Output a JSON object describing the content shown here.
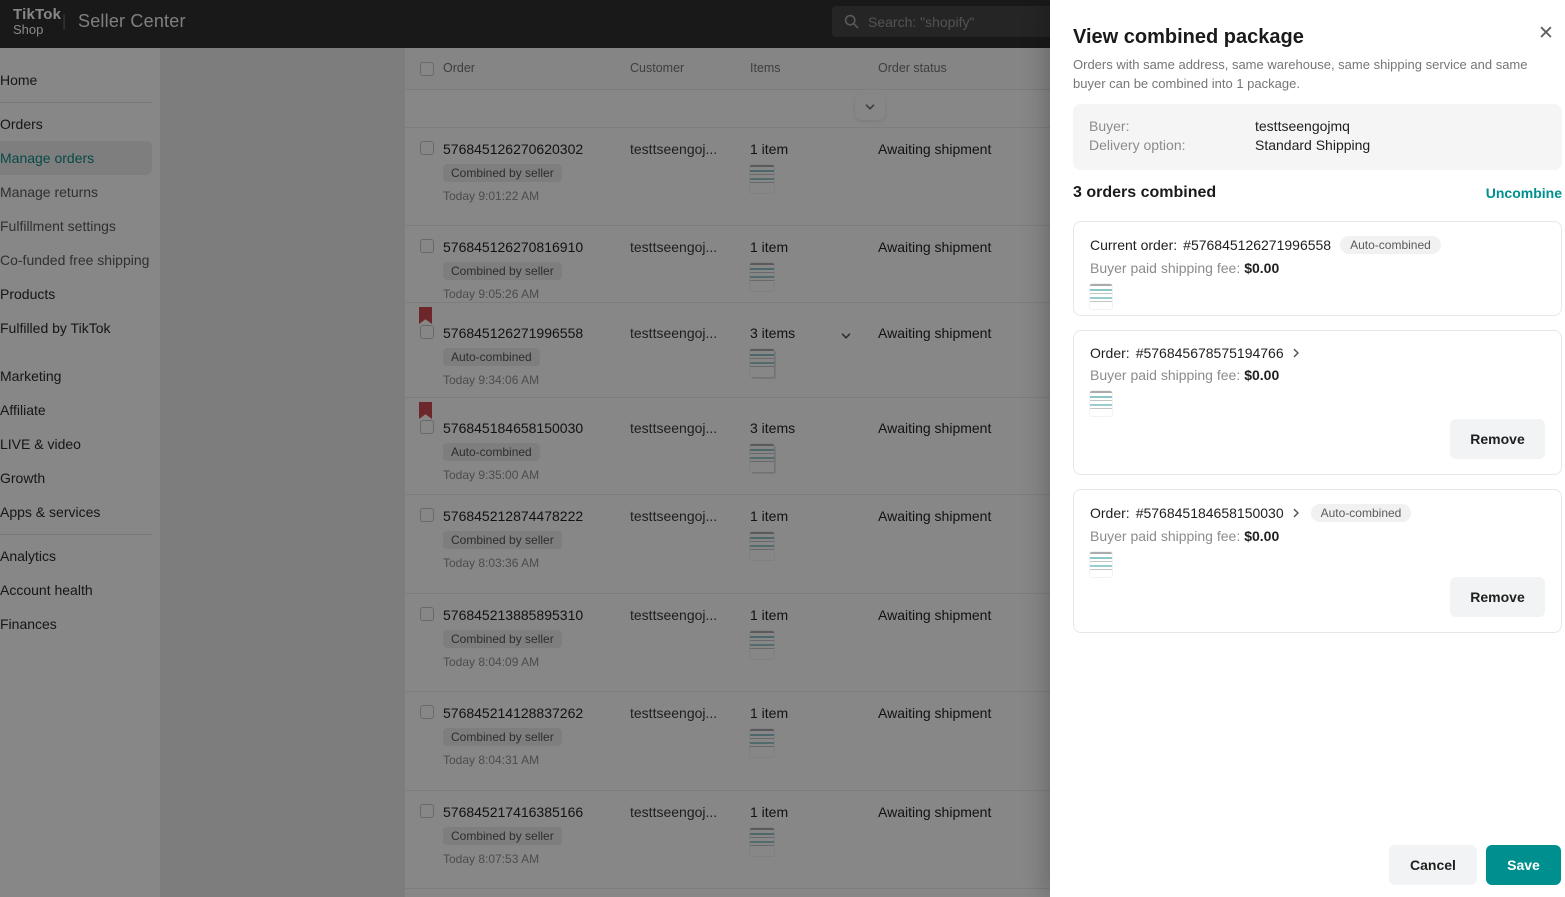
{
  "topbar": {
    "logo_line1": "TikTok",
    "logo_line2": "Shop",
    "divider": "|",
    "app_title": "Seller Center",
    "search_placeholder": "Search: \"shopify\""
  },
  "sidebar": {
    "items": [
      {
        "label": "Home"
      },
      {
        "label": "Orders"
      },
      {
        "label": "Manage orders",
        "active": true
      },
      {
        "label": "Manage returns"
      },
      {
        "label": "Fulfillment settings"
      },
      {
        "label": "Co-funded free shipping"
      },
      {
        "label": "Products"
      },
      {
        "label": "Fulfilled by TikTok"
      },
      {
        "label": "Marketing"
      },
      {
        "label": "Affiliate"
      },
      {
        "label": "LIVE & video"
      },
      {
        "label": "Growth"
      },
      {
        "label": "Apps & services"
      },
      {
        "label": "Analytics"
      },
      {
        "label": "Account health"
      },
      {
        "label": "Finances"
      }
    ]
  },
  "table": {
    "columns": {
      "order": "Order",
      "customer": "Customer",
      "items": "Items",
      "status": "Order status"
    },
    "rows": [
      {
        "order_no": "576845126270620302",
        "badge": "Combined by seller",
        "time": "Today 9:01:22 AM",
        "customer": "testtseengoj...",
        "items": "1 item",
        "status": "Awaiting shipment"
      },
      {
        "order_no": "576845126270816910",
        "badge": "Combined by seller",
        "time": "Today 9:05:26 AM",
        "customer": "testtseengoj...",
        "items": "1 item",
        "status": "Awaiting shipment"
      },
      {
        "order_no": "576845126271996558",
        "badge": "Auto-combined",
        "time": "Today 9:34:06 AM",
        "customer": "testtseengoj...",
        "items": "3 items",
        "status": "Awaiting shipment"
      },
      {
        "order_no": "576845184658150030",
        "badge": "Auto-combined",
        "time": "Today 9:35:00 AM",
        "customer": "testtseengoj...",
        "items": "3 items",
        "status": "Awaiting shipment"
      },
      {
        "order_no": "576845212874478222",
        "badge": "Combined by seller",
        "time": "Today 8:03:36 AM",
        "customer": "testtseengoj...",
        "items": "1 item",
        "status": "Awaiting shipment"
      },
      {
        "order_no": "576845213885895310",
        "badge": "Combined by seller",
        "time": "Today 8:04:09 AM",
        "customer": "testtseengoj...",
        "items": "1 item",
        "status": "Awaiting shipment"
      },
      {
        "order_no": "576845214128837262",
        "badge": "Combined by seller",
        "time": "Today 8:04:31 AM",
        "customer": "testtseengoj...",
        "items": "1 item",
        "status": "Awaiting shipment"
      },
      {
        "order_no": "576845217416385166",
        "badge": "Combined by seller",
        "time": "Today 8:07:53 AM",
        "customer": "testtseengoj...",
        "items": "1 item",
        "status": "Awaiting shipment"
      }
    ]
  },
  "drawer": {
    "title": "View combined package",
    "subtitle": "Orders with same address, same warehouse, same shipping service and same buyer can be combined into 1 package.",
    "close_glyph": "✕",
    "info": {
      "buyer_label": "Buyer:",
      "buyer_value": "testtseengojmq",
      "delivery_label": "Delivery option:",
      "delivery_value": "Standard Shipping"
    },
    "section_title": "3 orders combined",
    "uncombine_label": "Uncombine",
    "fee_label": "Buyer paid shipping fee:",
    "cards": [
      {
        "prefix": "Current order:",
        "order_number": "#576845126271996558",
        "badge": "Auto-combined",
        "fee_value": "$0.00"
      },
      {
        "prefix": "Order:",
        "order_number": "#576845678575194766",
        "fee_value": "$0.00",
        "remove_label": "Remove"
      },
      {
        "prefix": "Order:",
        "order_number": "#576845184658150030",
        "badge": "Auto-combined",
        "fee_value": "$0.00",
        "remove_label": "Remove"
      }
    ],
    "footer": {
      "cancel_label": "Cancel",
      "save_label": "Save"
    }
  },
  "colors": {
    "accent_teal": "#008F8F",
    "bookmark_red": "#CF4A52",
    "topbar_bg": "#303030"
  }
}
